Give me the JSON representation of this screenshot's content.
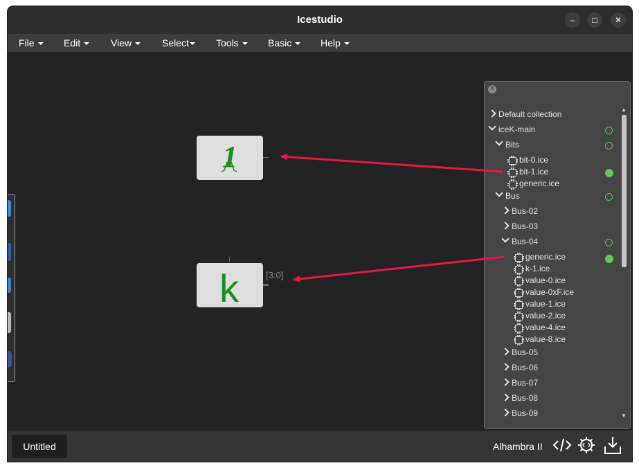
{
  "window": {
    "title": "Icestudio",
    "controls": [
      "–",
      "□",
      "✕"
    ]
  },
  "menu": [
    {
      "label": "File"
    },
    {
      "label": "Edit"
    },
    {
      "label": "View"
    },
    {
      "label": "Select"
    },
    {
      "label": "Tools"
    },
    {
      "label": "Basic"
    },
    {
      "label": "Help"
    }
  ],
  "canvas": {
    "block1_glyph": "1",
    "block2_glyph": "k",
    "bus_label": "[3:0]"
  },
  "collections": {
    "close_icon": "close-icon",
    "items": [
      {
        "label": "Default collection",
        "expanded": false
      },
      {
        "label": "iceK-main",
        "expanded": true,
        "status": "ring"
      },
      {
        "label": "Bits",
        "expanded": true,
        "status": "ring"
      },
      {
        "label": "bit-0.ice"
      },
      {
        "label": "bit-1.ice",
        "status": "dot"
      },
      {
        "label": "generic.ice"
      },
      {
        "label": "Bus",
        "expanded": true,
        "status": "ring"
      },
      {
        "label": "Bus-02",
        "expanded": false
      },
      {
        "label": "Bus-03",
        "expanded": false
      },
      {
        "label": "Bus-04",
        "expanded": true,
        "status": "ring"
      },
      {
        "label": "generic.ice",
        "status": "dot"
      },
      {
        "label": "k-1.ice"
      },
      {
        "label": "value-0.ice"
      },
      {
        "label": "value-0xF.ice"
      },
      {
        "label": "value-1.ice"
      },
      {
        "label": "value-2.ice"
      },
      {
        "label": "value-4.ice"
      },
      {
        "label": "value-8.ice"
      },
      {
        "label": "Bus-05",
        "expanded": false
      },
      {
        "label": "Bus-06",
        "expanded": false
      },
      {
        "label": "Bus-07",
        "expanded": false
      },
      {
        "label": "Bus-08",
        "expanded": false
      },
      {
        "label": "Bus-09",
        "expanded": false
      }
    ]
  },
  "bottom": {
    "tab": "Untitled",
    "board": "Alhambra II",
    "icons": [
      "code-icon",
      "gear-chip-icon",
      "download-icon"
    ]
  },
  "colors": {
    "arrow": "#e8183e",
    "block_glyph": "#1e8c1e",
    "status_green": "#5ecb5e"
  }
}
